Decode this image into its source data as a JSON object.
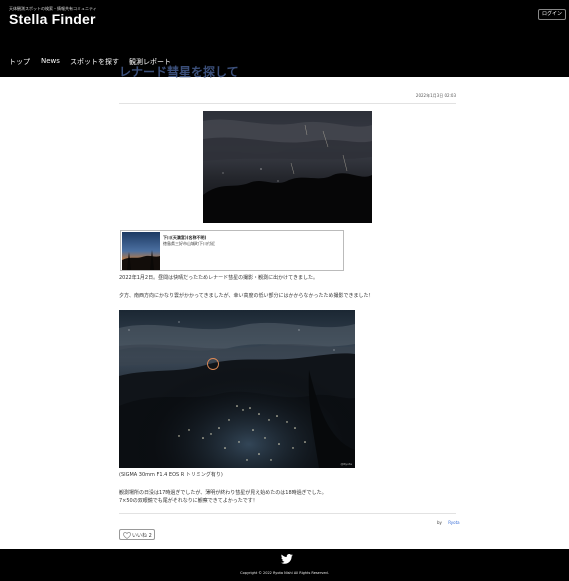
{
  "header": {
    "tagline": "天体観測スポットの検索・情報共有コミュニティ",
    "site_title": "Stella Finder",
    "login_label": "ログイン"
  },
  "nav": {
    "items": [
      {
        "label": "トップ"
      },
      {
        "label": "News"
      },
      {
        "label": "スポットを探す"
      },
      {
        "label": "観測レポート"
      }
    ]
  },
  "article": {
    "title": "レナード彗星を探して",
    "date": "2022年1月3日 02:03",
    "spot": {
      "name": "下川(天満宮)(名称不明)",
      "address": "徳島県三好市山城町下川付近"
    },
    "paragraphs": [
      "2022年1月2日。昼間は快晴だったためレナード彗星の撮影・観測に出かけてきました。",
      "夕方、南西方向にかなり雲がかかってきましたが、幸い高度の低い部分にはかからなかったため撮影できました！"
    ],
    "caption": "(SIGMA 30mm F1.4 EOS R トリミング有り)",
    "closing": [
      "観測場所の日没は17時過ぎでしたが、薄明が終わり彗星が見え始めたのは18時過ぎでした。",
      "7×50の双眼鏡でも尾がそれなりに観察できてよかったです！"
    ],
    "byline_prefix": "by",
    "author": "Ryota",
    "like_label": "いいね 2",
    "photo_watermark": "@Ryota"
  },
  "footer": {
    "copyright": "Copyright © 2022 Ryota Nishi All Rights Reserved."
  },
  "colors": {
    "header_bg": "#000000",
    "title_color": "#3b4f7a",
    "link_color": "#3a6fd8"
  },
  "icons": [
    "heart-icon",
    "twitter-icon"
  ]
}
